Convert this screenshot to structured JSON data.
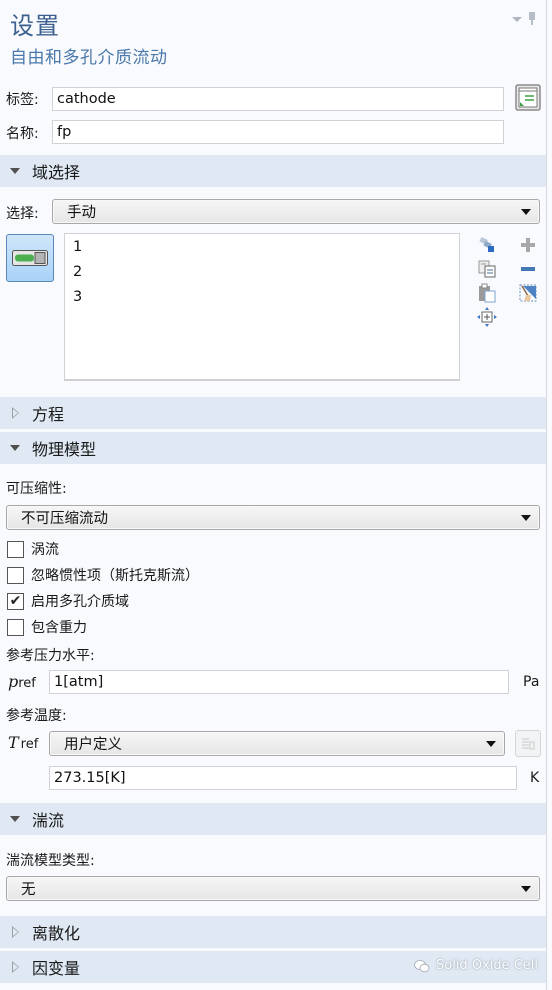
{
  "header": {
    "title": "设置",
    "subtitle": "自由和多孔介质流动"
  },
  "fields": {
    "label_caption": "标签:",
    "label_value": "cathode",
    "name_caption": "名称:",
    "name_value": "fp"
  },
  "sections": {
    "domain_selection": "域选择",
    "equations": "方程",
    "physical_model": "物理模型",
    "turbulence": "湍流",
    "discretization": "离散化",
    "dependent_variables": "因变量"
  },
  "domain_selection": {
    "selection_caption": "选择:",
    "selection_value": "手动",
    "items": [
      "1",
      "2",
      "3"
    ]
  },
  "physical_model": {
    "compressibility_caption": "可压缩性:",
    "compressibility_value": "不可压缩流动",
    "checkboxes": [
      {
        "label": "涡流",
        "checked": false
      },
      {
        "label": "忽略惯性项（斯托克斯流）",
        "checked": false
      },
      {
        "label": "启用多孔介质域",
        "checked": true
      },
      {
        "label": "包含重力",
        "checked": false
      }
    ],
    "ref_pressure_caption": "参考压力水平:",
    "p_ref_symbol": "p",
    "p_ref_sub": "ref",
    "p_ref_value": "1[atm]",
    "p_ref_unit": "Pa",
    "ref_temperature_caption": "参考温度:",
    "t_ref_symbol": "T",
    "t_ref_sub": "ref",
    "t_ref_option": "用户定义",
    "t_ref_value": "273.15[K]",
    "t_ref_unit": "K"
  },
  "turbulence": {
    "model_type_caption": "湍流模型类型:",
    "model_type_value": "无"
  },
  "watermark": "Solid Oxide Cell",
  "colors": {
    "title": "#3c5f8f",
    "section_bg": "#dfe8f3",
    "panel_bg": "#f8fafe"
  }
}
